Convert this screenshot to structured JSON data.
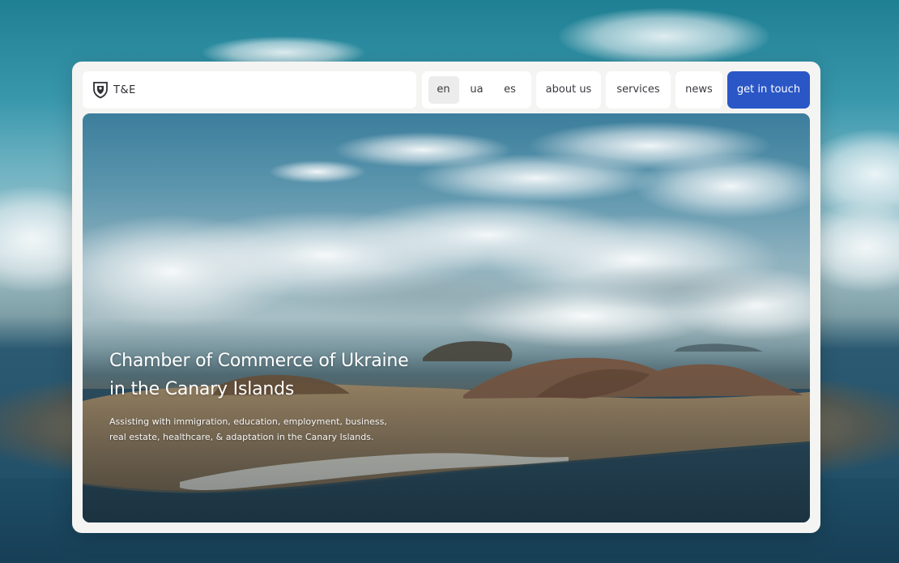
{
  "brand": {
    "name": "T&E",
    "logo_icon": "shield-crest-icon"
  },
  "nav": {
    "languages": [
      {
        "label": "en",
        "active": true
      },
      {
        "label": "ua",
        "active": false
      },
      {
        "label": "es",
        "active": false
      }
    ],
    "links": {
      "about": "about us",
      "services": "services",
      "news": "news"
    },
    "cta": "get in touch"
  },
  "hero": {
    "title_line1": "Chamber of Commerce of Ukraine",
    "title_line2": "in the Canary Islands",
    "subtitle_line1": "Assisting with immigration, education, employment, business,",
    "subtitle_line2": "real estate, healthcare, & adaptation in the Canary Islands."
  },
  "colors": {
    "cta_background": "#2a56c6",
    "window_background": "#f4f4f3",
    "nav_pill_background": "#ffffff",
    "active_language_background": "#ececec"
  }
}
